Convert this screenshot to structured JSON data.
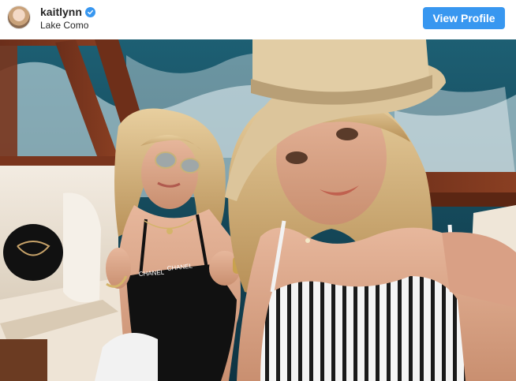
{
  "post": {
    "username": "kaitlynn",
    "location": "Lake Como",
    "view_profile_label": "View Profile"
  },
  "photo": {
    "swimsuit_text_left": "CHANEL",
    "swimsuit_text_right": "CHANEL"
  },
  "colors": {
    "accent": "#3897f0",
    "text": "#262626"
  },
  "icons": {
    "verified": "verified-badge-icon"
  }
}
